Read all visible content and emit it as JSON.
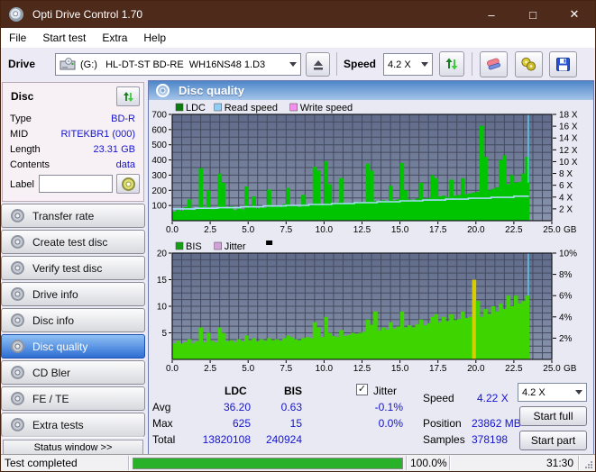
{
  "window": {
    "title": "Opti Drive Control 1.70",
    "minimize_glyph": "–",
    "maximize_glyph": "□",
    "close_glyph": "✕"
  },
  "menu": {
    "items": [
      "File",
      "Start test",
      "Extra",
      "Help"
    ]
  },
  "toolbar": {
    "drive_label": "Drive",
    "drive_value": "(G:)   HL-DT-ST BD-RE  WH16NS48 1.D3",
    "speed_label": "Speed",
    "speed_value": "4.2 X",
    "icons": [
      "drive-icon",
      "eject-icon",
      "refresh-icon",
      "eraser-icon",
      "search-discs-icon",
      "save-icon"
    ]
  },
  "sidebar": {
    "disc_panel": {
      "title": "Disc",
      "rows": [
        {
          "label": "Type",
          "value": "BD-R"
        },
        {
          "label": "MID",
          "value": "RITEKBR1 (000)"
        },
        {
          "label": "Length",
          "value": "23.31 GB"
        },
        {
          "label": "Contents",
          "value": "data"
        }
      ],
      "label_label": "Label",
      "label_value": ""
    },
    "nav": [
      {
        "label": "Transfer rate",
        "selected": false
      },
      {
        "label": "Create test disc",
        "selected": false
      },
      {
        "label": "Verify test disc",
        "selected": false
      },
      {
        "label": "Drive info",
        "selected": false
      },
      {
        "label": "Disc info",
        "selected": false
      },
      {
        "label": "Disc quality",
        "selected": true
      },
      {
        "label": "CD Bler",
        "selected": false
      },
      {
        "label": "FE / TE",
        "selected": false
      },
      {
        "label": "Extra tests",
        "selected": false
      }
    ],
    "status_window_label": "Status window >>"
  },
  "main": {
    "header": "Disc quality"
  },
  "chart_data": [
    {
      "type": "bar",
      "title": "LDC / Read speed / Write speed vs position",
      "legend": [
        {
          "label": "LDC",
          "color": "#0b7c0b"
        },
        {
          "label": "Read speed",
          "color": "#92cef4"
        },
        {
          "label": "Write speed",
          "color": "#f490ec"
        }
      ],
      "x_unit": "GB",
      "xlim": [
        0,
        25
      ],
      "x_tick_labels": [
        "0.0",
        "2.5",
        "5.0",
        "7.5",
        "10.0",
        "12.5",
        "15.0",
        "17.5",
        "20.0",
        "22.5",
        "25.0"
      ],
      "x_minor_step": 0.625,
      "ylim_left": [
        0,
        700
      ],
      "y_left_tick_labels": [
        "100",
        "200",
        "300",
        "400",
        "500",
        "600",
        "700"
      ],
      "y_left_minor_step": 50,
      "y_right_axis": {
        "max": 18,
        "tick_values": [
          2,
          4,
          6,
          8,
          10,
          12,
          14,
          16,
          18
        ],
        "tick_labels": [
          "2 X",
          "4 X",
          "6 X",
          "8 X",
          "10 X",
          "12 X",
          "14 X",
          "16 X",
          "18 X"
        ]
      },
      "bars": {
        "name": "LDC",
        "color": "#00c400",
        "x_start": 0,
        "x_step": 0.25,
        "values": [
          60,
          75,
          65,
          90,
          140,
          70,
          80,
          345,
          90,
          200,
          75,
          85,
          310,
          250,
          80,
          95,
          70,
          90,
          75,
          225,
          90,
          160,
          80,
          95,
          85,
          205,
          90,
          100,
          90,
          110,
          215,
          95,
          100,
          90,
          170,
          105,
          100,
          355,
          330,
          110,
          390,
          240,
          110,
          120,
          280,
          115,
          110,
          120,
          115,
          125,
          120,
          375,
          330,
          130,
          125,
          135,
          130,
          230,
          135,
          140,
          380,
          200,
          140,
          135,
          145,
          250,
          145,
          150,
          300,
          280,
          160,
          165,
          155,
          270,
          165,
          170,
          280,
          175,
          180,
          185,
          190,
          625,
          420,
          200,
          210,
          220,
          400,
          430,
          240,
          300,
          250,
          255,
          310,
          420
        ]
      },
      "line": {
        "name": "Read speed",
        "color": "#a8dcf8",
        "axis": "right",
        "points": [
          [
            0,
            2.0
          ],
          [
            1.5,
            2.1
          ],
          [
            3,
            2.2
          ],
          [
            4.5,
            2.35
          ],
          [
            6,
            2.5
          ],
          [
            7.5,
            2.6
          ],
          [
            9,
            2.75
          ],
          [
            10.5,
            2.9
          ],
          [
            12,
            3.05
          ],
          [
            13.5,
            3.2
          ],
          [
            15,
            3.35
          ],
          [
            16.5,
            3.5
          ],
          [
            18,
            3.65
          ],
          [
            19.5,
            3.8
          ],
          [
            21,
            3.95
          ],
          [
            22.5,
            4.15
          ],
          [
            23.45,
            4.25
          ]
        ]
      },
      "cursor": {
        "x": 23.45,
        "color": "#55c8f2",
        "to_left_value": 250
      }
    },
    {
      "type": "bar",
      "title": "BIS / Jitter vs position",
      "legend": [
        {
          "label": "BIS",
          "color": "#14a014"
        },
        {
          "label": "Jitter",
          "color": "#d2a2d6"
        }
      ],
      "legend_extra_marker_color": "#000000",
      "x_unit": "GB",
      "xlim": [
        0,
        25
      ],
      "x_tick_labels": [
        "0.0",
        "2.5",
        "5.0",
        "7.5",
        "10.0",
        "12.5",
        "15.0",
        "17.5",
        "20.0",
        "22.5",
        "25.0"
      ],
      "x_minor_step": 0.625,
      "ylim_left": [
        0,
        20
      ],
      "y_left_tick_labels": [
        "5",
        "10",
        "15",
        "20"
      ],
      "y_left_minor_step": 1.25,
      "y_right_axis": {
        "max": 10,
        "tick_values": [
          2,
          4,
          6,
          8,
          10
        ],
        "tick_labels": [
          "2%",
          "4%",
          "6%",
          "8%",
          "10%"
        ]
      },
      "bars": {
        "name": "BIS",
        "color": "#3ed400",
        "x_start": 0,
        "x_step": 0.25,
        "values": [
          3,
          3.5,
          3,
          3.2,
          3.8,
          3,
          3.4,
          6,
          3.2,
          5,
          3.5,
          3.2,
          6,
          5,
          3.4,
          3.6,
          3.2,
          3.8,
          3.4,
          4.5,
          3.6,
          4,
          3.4,
          3.8,
          3.5,
          4,
          3.6,
          3.8,
          3.5,
          4,
          4.5,
          4.2,
          3.8,
          3.6,
          4,
          4.2,
          4,
          7,
          6,
          4.2,
          8,
          5,
          4.4,
          4.2,
          5.5,
          4.4,
          4.6,
          5,
          4.8,
          5,
          5.2,
          7.5,
          6.5,
          9,
          5.4,
          6,
          5.6,
          7,
          5.8,
          6.2,
          9,
          6,
          6.4,
          6,
          6.6,
          7.5,
          6.4,
          6.8,
          8,
          8.5,
          7,
          8,
          7.2,
          8.5,
          7.4,
          7.6,
          9,
          7.8,
          8,
          15,
          11,
          8,
          9.5,
          8.5,
          10,
          9,
          10.5,
          9.5,
          12,
          10,
          12,
          10.5,
          11,
          12
        ],
        "highlight": {
          "index": 79,
          "color": "#d6ce00"
        }
      },
      "cursor": {
        "x": 23.45,
        "color": "#55c8f2",
        "to_left_value": 12
      }
    }
  ],
  "stats": {
    "col_headers": {
      "ldc": "LDC",
      "bis": "BIS"
    },
    "row_labels": {
      "avg": "Avg",
      "max": "Max",
      "total": "Total"
    },
    "ldc": {
      "avg": "36.20",
      "max": "625",
      "total": "13820108"
    },
    "bis": {
      "avg": "0.63",
      "max": "15",
      "total": "240924"
    },
    "jitter": {
      "label": "Jitter",
      "checked": true,
      "check_glyph": "✓",
      "avg": "-0.1%",
      "max": "0.0%"
    },
    "speed_label": "Speed",
    "speed_value": "4.22 X",
    "position_label": "Position",
    "position_value": "23862 MB",
    "samples_label": "Samples",
    "samples_value": "378198",
    "speed_select": "4.2 X",
    "start_full": "Start full",
    "start_part": "Start part"
  },
  "statusbar": {
    "text": "Test completed",
    "progress_percent": 100,
    "progress_text": "100.0%",
    "time": "31:30"
  },
  "colors": {
    "titlebar": "#4e2a1b",
    "nav_selected": "#2e6ed3",
    "value_text": "#1515cc",
    "progress_green": "#29b129",
    "chart_bg_top": "#5f6b89",
    "chart_bg_bottom": "#8994ac"
  }
}
